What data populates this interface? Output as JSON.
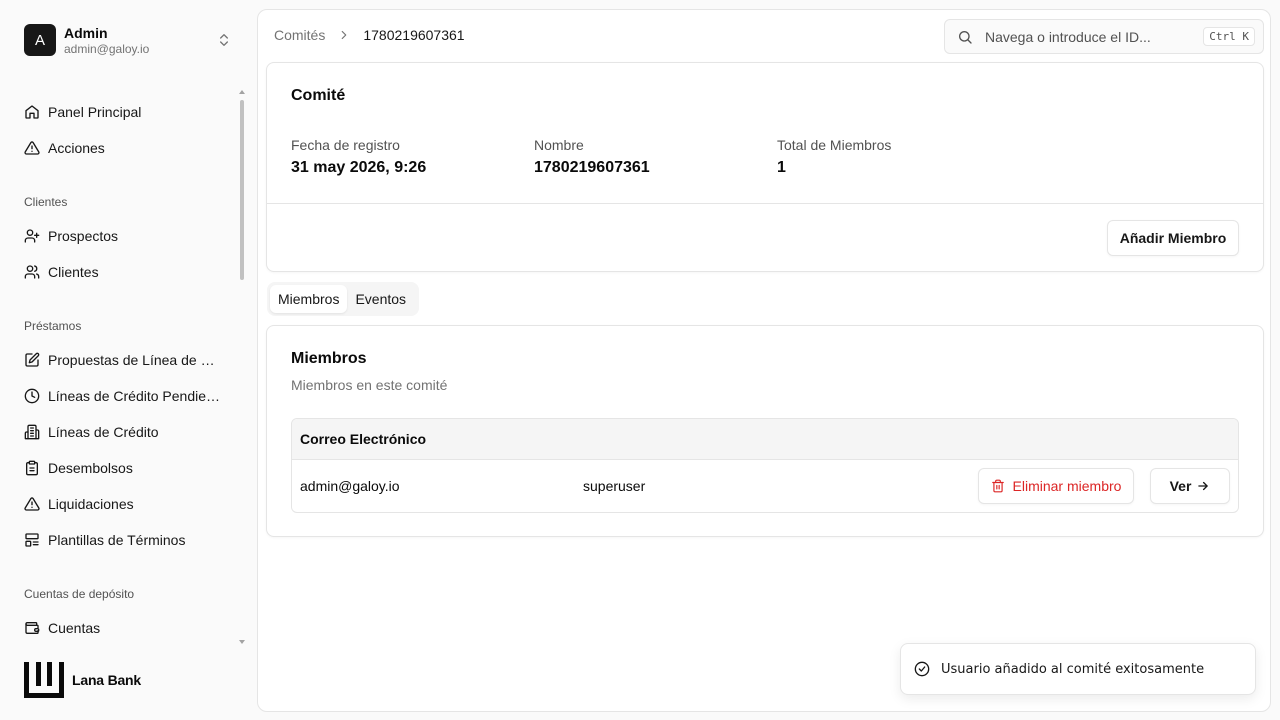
{
  "user": {
    "initial": "A",
    "name": "Admin",
    "email": "admin@galoy.io"
  },
  "nav": {
    "items_top": [
      {
        "label": "Panel Principal",
        "icon": "home-icon"
      },
      {
        "label": "Acciones",
        "icon": "alert-triangle-icon"
      }
    ],
    "groups": [
      {
        "label": "Clientes",
        "items": [
          {
            "label": "Prospectos",
            "icon": "user-plus-icon"
          },
          {
            "label": "Clientes",
            "icon": "users-icon"
          }
        ]
      },
      {
        "label": "Préstamos",
        "items": [
          {
            "label": "Propuestas de Línea de Cr...",
            "icon": "edit-icon"
          },
          {
            "label": "Líneas de Crédito Pendient...",
            "icon": "clock-icon"
          },
          {
            "label": "Líneas de Crédito",
            "icon": "building-icon"
          },
          {
            "label": "Desembolsos",
            "icon": "clipboard-icon"
          },
          {
            "label": "Liquidaciones",
            "icon": "alert-triangle-icon"
          },
          {
            "label": "Plantillas de Términos",
            "icon": "layout-icon"
          }
        ]
      },
      {
        "label": "Cuentas de depósito",
        "items": [
          {
            "label": "Cuentas",
            "icon": "wallet-icon"
          }
        ]
      }
    ]
  },
  "brand": {
    "name": "Lana Bank"
  },
  "breadcrumb": {
    "parent": "Comités",
    "current": "1780219607361"
  },
  "search": {
    "placeholder": "Navega o introduce el ID...",
    "shortcut": "Ctrl K"
  },
  "committee": {
    "title": "Comité",
    "fields": [
      {
        "label": "Fecha de registro",
        "value": "31 may 2026, 9:26"
      },
      {
        "label": "Nombre",
        "value": "1780219607361"
      },
      {
        "label": "Total de Miembros",
        "value": "1"
      }
    ],
    "add_member_label": "Añadir Miembro"
  },
  "tabs": [
    {
      "label": "Miembros",
      "active": true
    },
    {
      "label": "Eventos",
      "active": false
    }
  ],
  "members": {
    "title": "Miembros",
    "subtitle": "Miembros en este comité",
    "column_email": "Correo Electrónico",
    "rows": [
      {
        "email": "admin@galoy.io",
        "role": "superuser",
        "remove_label": "Eliminar miembro",
        "view_label": "Ver"
      }
    ]
  },
  "toast": {
    "message": "Usuario añadido al comité exitosamente"
  },
  "colors": {
    "danger": "#dc2626",
    "text": "#0a0a0a",
    "muted": "#737373",
    "border": "#e5e5e5"
  }
}
